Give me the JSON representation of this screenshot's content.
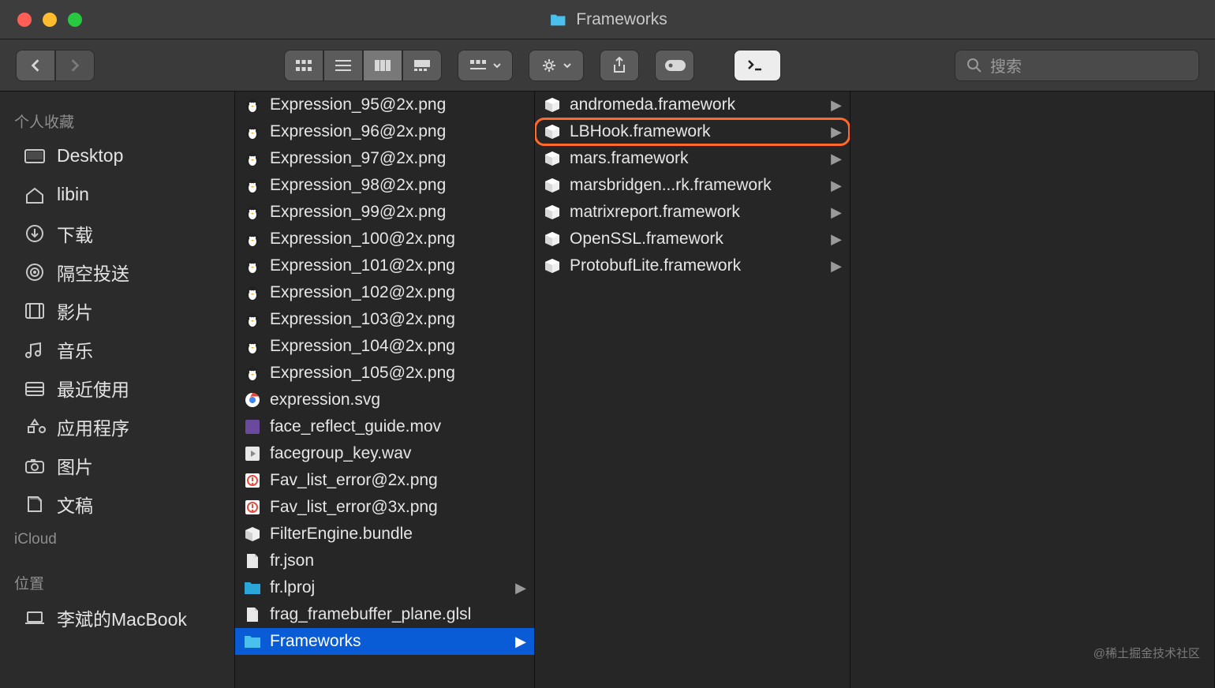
{
  "window": {
    "title": "Frameworks"
  },
  "search": {
    "placeholder": "搜索"
  },
  "sidebar": {
    "sections": [
      {
        "label": "个人收藏",
        "items": [
          {
            "icon": "desktop",
            "label": "Desktop"
          },
          {
            "icon": "home",
            "label": "libin"
          },
          {
            "icon": "download",
            "label": "下载"
          },
          {
            "icon": "airdrop",
            "label": "隔空投送"
          },
          {
            "icon": "film",
            "label": "影片"
          },
          {
            "icon": "music",
            "label": "音乐"
          },
          {
            "icon": "recent",
            "label": "最近使用"
          },
          {
            "icon": "apps",
            "label": "应用程序"
          },
          {
            "icon": "camera",
            "label": "图片"
          },
          {
            "icon": "documents",
            "label": "文稿"
          }
        ]
      },
      {
        "label": "iCloud",
        "items": []
      },
      {
        "label": "位置",
        "items": [
          {
            "icon": "laptop",
            "label": "李斌的MacBook"
          }
        ]
      }
    ]
  },
  "column1": [
    {
      "icon": "penguin",
      "name": "Expression_95@2x.png"
    },
    {
      "icon": "penguin",
      "name": "Expression_96@2x.png"
    },
    {
      "icon": "penguin",
      "name": "Expression_97@2x.png"
    },
    {
      "icon": "penguin",
      "name": "Expression_98@2x.png"
    },
    {
      "icon": "penguin",
      "name": "Expression_99@2x.png"
    },
    {
      "icon": "penguin",
      "name": "Expression_100@2x.png"
    },
    {
      "icon": "penguin",
      "name": "Expression_101@2x.png"
    },
    {
      "icon": "penguin",
      "name": "Expression_102@2x.png"
    },
    {
      "icon": "penguin",
      "name": "Expression_103@2x.png"
    },
    {
      "icon": "penguin",
      "name": "Expression_104@2x.png"
    },
    {
      "icon": "penguin",
      "name": "Expression_105@2x.png"
    },
    {
      "icon": "chrome",
      "name": "expression.svg"
    },
    {
      "icon": "mov",
      "name": "face_reflect_guide.mov"
    },
    {
      "icon": "wav",
      "name": "facegroup_key.wav"
    },
    {
      "icon": "error",
      "name": "Fav_list_error@2x.png"
    },
    {
      "icon": "error",
      "name": "Fav_list_error@3x.png"
    },
    {
      "icon": "bundle",
      "name": "FilterEngine.bundle"
    },
    {
      "icon": "file",
      "name": "fr.json"
    },
    {
      "icon": "folder",
      "name": "fr.lproj",
      "hasChildren": true
    },
    {
      "icon": "file",
      "name": "frag_framebuffer_plane.glsl"
    },
    {
      "icon": "folder-open",
      "name": "Frameworks",
      "hasChildren": true,
      "selected": true
    }
  ],
  "column2": [
    {
      "icon": "framework",
      "name": "andromeda.framework",
      "hasChildren": true
    },
    {
      "icon": "framework",
      "name": "LBHook.framework",
      "hasChildren": true,
      "highlighted": true
    },
    {
      "icon": "framework",
      "name": "mars.framework",
      "hasChildren": true
    },
    {
      "icon": "framework",
      "name": "marsbridgen...rk.framework",
      "hasChildren": true
    },
    {
      "icon": "framework",
      "name": "matrixreport.framework",
      "hasChildren": true
    },
    {
      "icon": "framework",
      "name": "OpenSSL.framework",
      "hasChildren": true
    },
    {
      "icon": "framework",
      "name": "ProtobufLite.framework",
      "hasChildren": true
    }
  ],
  "watermark": "@稀土掘金技术社区"
}
